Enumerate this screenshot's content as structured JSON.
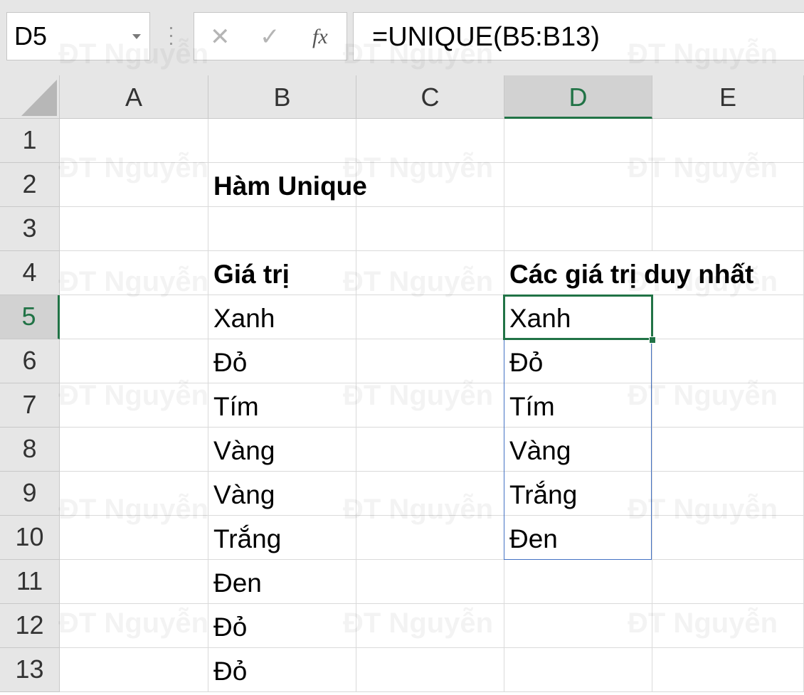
{
  "name_box": {
    "value": "D5"
  },
  "formula_bar": {
    "cancel_glyph": "✕",
    "enter_glyph": "✓",
    "insert_function_glyph": "fx",
    "formula": "=UNIQUE(B5:B13)"
  },
  "columns": [
    "A",
    "B",
    "C",
    "D",
    "E"
  ],
  "rows": [
    "1",
    "2",
    "3",
    "4",
    "5",
    "6",
    "7",
    "8",
    "9",
    "10",
    "11",
    "12",
    "13"
  ],
  "selected_column": "D",
  "selected_row": "5",
  "sheet": {
    "title": "Hàm Unique",
    "header_values": "Giá trị",
    "header_unique": "Các giá trị duy nhất",
    "values": [
      "Xanh",
      "Đỏ",
      "Tím",
      "Vàng",
      "Vàng",
      "Trắng",
      "Đen",
      "Đỏ",
      "Đỏ"
    ],
    "unique_values": [
      "Xanh",
      "Đỏ",
      "Tím",
      "Vàng",
      "Trắng",
      "Đen"
    ]
  },
  "watermark": "ĐT Nguyễn",
  "colors": {
    "accent": "#217346",
    "spill_border": "#4472c4",
    "header_bg": "#e6e6e6"
  }
}
